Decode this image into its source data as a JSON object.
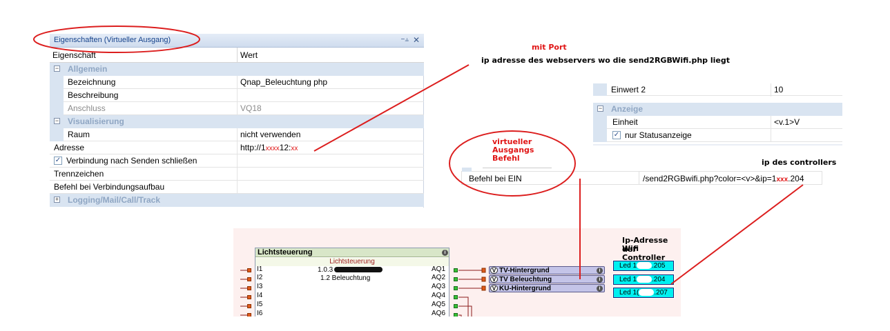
{
  "properties_panel": {
    "title": "Eigenschaften (Virtueller Ausgang)",
    "pin_icon": "pin-icon",
    "close_icon": "close-icon",
    "col_property": "Eigenschaft",
    "col_value": "Wert",
    "rows": [
      {
        "kind": "category",
        "label": "Allgemein",
        "toggle": "⊟"
      },
      {
        "kind": "row",
        "label": "Bezeichnung",
        "value": "Qnap_Beleuchtung php"
      },
      {
        "kind": "row",
        "label": "Beschreibung",
        "value": ""
      },
      {
        "kind": "row",
        "label": "Anschluss",
        "value": "VQ18"
      },
      {
        "kind": "category",
        "label": "Visualisierung",
        "toggle": "⊟"
      },
      {
        "kind": "row",
        "label": "Raum",
        "value": "nicht verwenden"
      },
      {
        "kind": "row",
        "label": "Adresse",
        "value": "http://1"
      },
      {
        "kind": "row",
        "label": "Verbindung nach Senden schließen",
        "value": ""
      },
      {
        "kind": "row",
        "label": "Trennzeichen",
        "value": ""
      },
      {
        "kind": "row",
        "label": "Befehl bei Verbindungsaufbau",
        "value": ""
      },
      {
        "kind": "category",
        "label": "Logging/Mail/Call/Track",
        "toggle": "⊞"
      }
    ],
    "adresse_mid": "12:",
    "redact_marks": "xxxx",
    "redact_marks_2": "xx"
  },
  "annotations": {
    "mit_port": "mit Port",
    "ip_webserver": "ip adresse des webservers wo die  send2RGBWifi.php liegt",
    "virtueller": "virtueller",
    "ausgangs": "Ausgangs",
    "befehl": "Befehl",
    "ip_controllers": "ip des controllers",
    "ip_adresse_der": "Ip-Adresse der",
    "wifi_controller": "Wifi Controller"
  },
  "snippet2": {
    "cut_row_label": "Einwert 2",
    "cut_row_value": "10",
    "category": "Anzeige",
    "einheit_label": "Einheit",
    "einheit_value": "<v.1>V",
    "status_label": "nur Statusanzeige"
  },
  "befehl_ein": {
    "label": "Befehl bei EIN",
    "value_prefix": "/send2RGBwifi.php?color=<v>&ip=1",
    "value_redacted": "xxx",
    "value_suffix": ".204"
  },
  "logic": {
    "block_title": "Lichtsteuerung",
    "block_subtitle": "Lichtsteuerung",
    "line1": "1.0.3",
    "line2": "1.2 Beleuchtung",
    "inputs": [
      "I1",
      "I2",
      "I3",
      "I4",
      "I5",
      "I6"
    ],
    "outputs": [
      "AQ1",
      "AQ2",
      "AQ3",
      "AQ4",
      "AQ5",
      "AQ6"
    ],
    "virtual_outputs": [
      {
        "v": "V",
        "label": "TV-Hintergrund"
      },
      {
        "v": "V",
        "label": "TV Beleuchtung"
      },
      {
        "v": "V",
        "label": "KU-Hintergrund"
      }
    ],
    "leds": [
      {
        "prefix": "Led 1",
        "suffix": ".205"
      },
      {
        "prefix": "Led 1",
        "suffix": ".204"
      },
      {
        "prefix": "Led 1(",
        "suffix": ".207"
      }
    ],
    "info_glyph": "i"
  },
  "colors": {
    "annotation_red": "#e01515",
    "category_bg": "#d9e4f1",
    "led_cyan": "#00f0f0",
    "vout_bg": "#c4c4e8"
  }
}
